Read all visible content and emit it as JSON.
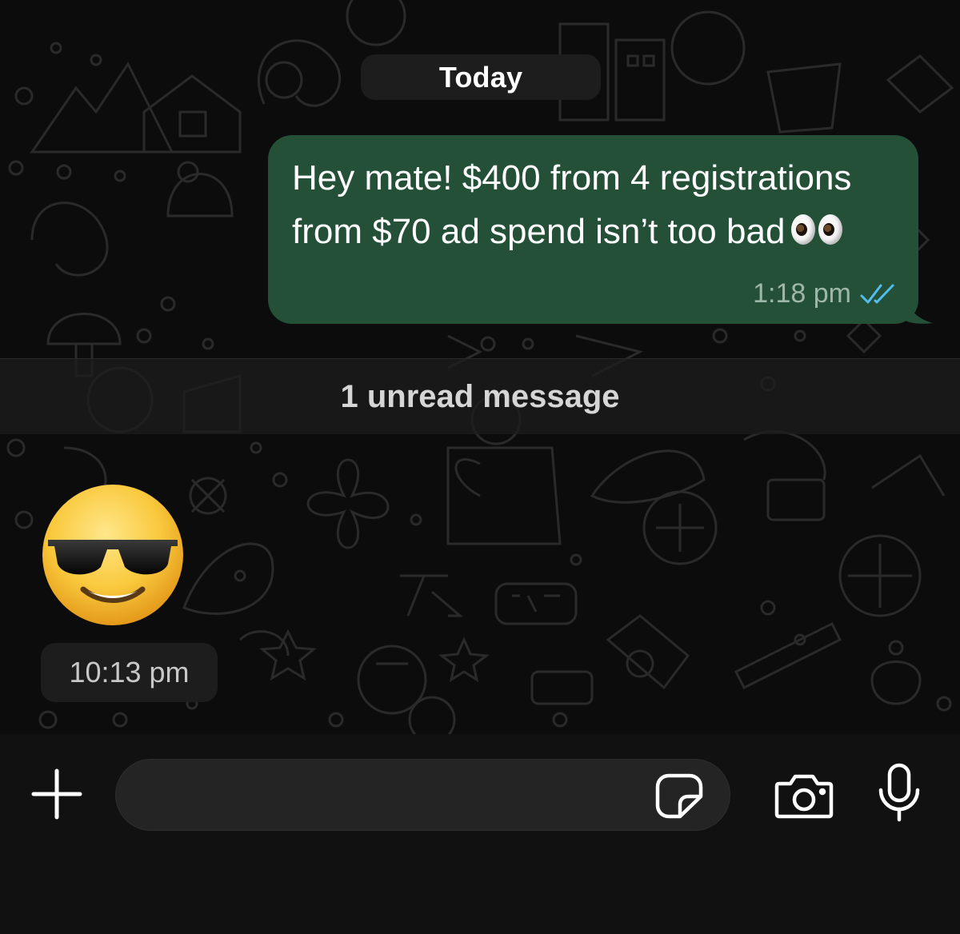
{
  "chat": {
    "date_separator": "Today",
    "outgoing_message": {
      "text_main": "Hey mate! $400 from 4 registrations from $70 ad spend isn’t too bad",
      "emoji": "eyes",
      "time": "1:18 pm",
      "status": "read"
    },
    "unread_banner": "1 unread message",
    "incoming_message": {
      "emoji": "smiling-face-with-sunglasses",
      "time": "10:13 pm"
    }
  },
  "input_bar": {
    "plus_icon": "plus-icon",
    "field_value": "",
    "sticker_icon": "sticker-icon",
    "camera_icon": "camera-icon",
    "mic_icon": "microphone-icon"
  },
  "colors": {
    "outgoing_bubble": "#245038",
    "read_ticks": "#53bdeb",
    "background": "#0c0c0c",
    "pill": "#1d1d1d"
  }
}
